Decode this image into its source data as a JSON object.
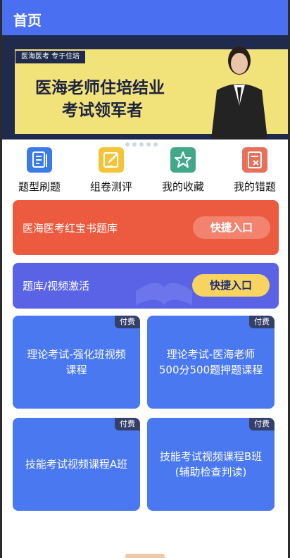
{
  "header": {
    "title": "首页"
  },
  "banner": {
    "tag": "医海医考 专于住培",
    "title_line1": "医海老师住培结业",
    "title_line2": "考试领军者",
    "page_count": 5
  },
  "shortcuts": [
    {
      "label": "题型刷题",
      "icon": "document-lines-icon",
      "color": "#3a7be6"
    },
    {
      "label": "组卷测评",
      "icon": "edit-pencil-icon",
      "color": "#f3c43a"
    },
    {
      "label": "我的收藏",
      "icon": "star-icon",
      "color": "#41a889"
    },
    {
      "label": "我的错题",
      "icon": "wrong-answer-icon",
      "color": "#e8705a"
    }
  ],
  "cards": [
    {
      "title": "医海医考红宝书题库",
      "button": "快捷入口",
      "color": "#ec5a3f"
    },
    {
      "title": "题库/视频激活",
      "button": "快捷入口",
      "color": "#5a63e6"
    }
  ],
  "courses": [
    {
      "badge": "付费",
      "lines": [
        "理论考试-强化班视频",
        "课程"
      ]
    },
    {
      "badge": "付费",
      "lines": [
        "理论考试-医海老师",
        "500分500题押题课程"
      ]
    },
    {
      "badge": "付费",
      "lines": [
        "技能考试视频课程A班"
      ]
    },
    {
      "badge": "付费",
      "lines": [
        "技能考试视频课程B班",
        "(辅助检查判读)"
      ]
    }
  ]
}
